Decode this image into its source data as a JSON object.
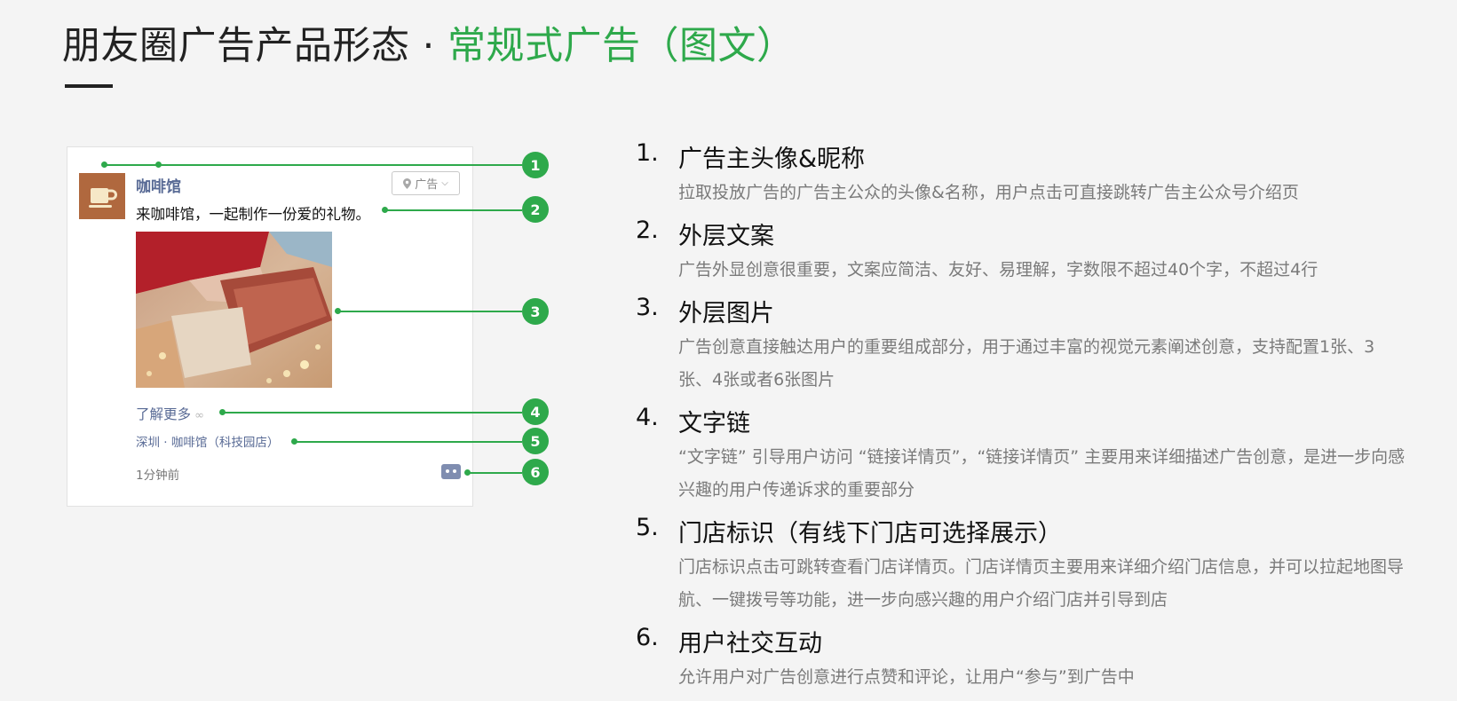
{
  "title": {
    "main": "朋友圈广告产品形态 · ",
    "highlight": "常规式广告（图文）"
  },
  "colors": {
    "accent": "#2ea94b",
    "link": "#586a95",
    "avatar_bg": "#b0683e"
  },
  "mockup": {
    "avatar_icon": "coffee-cup-icon",
    "nickname": "咖啡馆",
    "ad_tag": "广告",
    "copy": "来咖啡馆，一起制作一份爱的礼物。",
    "link_text": "了解更多",
    "store": "深圳 · 咖啡馆（科技园店）",
    "time": "1分钟前",
    "comment_icon": "comment-dots-icon"
  },
  "callouts": [
    "1",
    "2",
    "3",
    "4",
    "5",
    "6"
  ],
  "items": [
    {
      "num": "1.",
      "head": "广告主头像&昵称",
      "desc": "拉取投放广告的广告主公众的头像&名称，用户点击可直接跳转广告主公众号介绍页"
    },
    {
      "num": "2.",
      "head": "外层文案",
      "desc": "广告外显创意很重要，文案应简洁、友好、易理解，字数限不超过40个字，不超过4行"
    },
    {
      "num": "3.",
      "head": "外层图片",
      "desc": "广告创意直接触达用户的重要组成部分，用于通过丰富的视觉元素阐述创意，支持配置1张、3张、4张或者6张图片"
    },
    {
      "num": "4.",
      "head": "文字链",
      "desc": "“文字链” 引导用户访问 “链接详情页”，“链接详情页” 主要用来详细描述广告创意，是进一步向感兴趣的用户传递诉求的重要部分"
    },
    {
      "num": "5.",
      "head": "门店标识（有线下门店可选择展示）",
      "desc": "门店标识点击可跳转查看门店详情页。门店详情页主要用来详细介绍门店信息，并可以拉起地图导航、一键拨号等功能，进一步向感兴趣的用户介绍门店并引导到店"
    },
    {
      "num": "6.",
      "head": "用户社交互动",
      "desc": "允许用户对广告创意进行点赞和评论，让用户“参与”到广告中"
    }
  ]
}
